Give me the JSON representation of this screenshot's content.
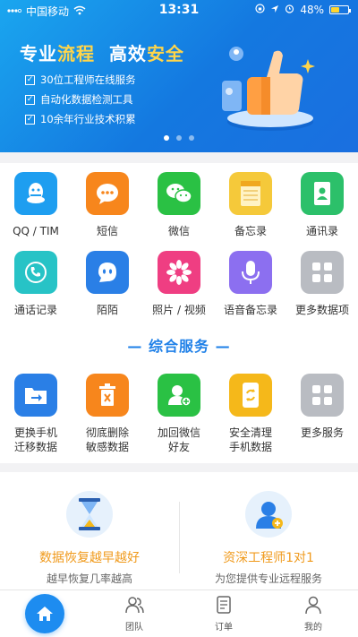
{
  "status_bar": {
    "carrier": "中国移动",
    "time": "13:31",
    "battery": "48%",
    "battery_level": 0.48
  },
  "banner": {
    "headline": {
      "part1": "专业",
      "part2": "流程",
      "part3": "高效",
      "part4": "安全"
    },
    "features": [
      "30位工程师在线服务",
      "自动化数据检测工具",
      "10余年行业技术积累"
    ],
    "carousel": {
      "count": 3,
      "active": 0
    },
    "illustration": "thumbs-up-illustration"
  },
  "data_items": [
    {
      "label": "QQ / TIM",
      "icon": "qq-icon",
      "color": "#1e9ef0"
    },
    {
      "label": "短信",
      "icon": "sms-icon",
      "color": "#f7861c"
    },
    {
      "label": "微信",
      "icon": "wechat-icon",
      "color": "#2ac144"
    },
    {
      "label": "备忘录",
      "icon": "memo-icon",
      "color": "#f5c93a"
    },
    {
      "label": "通讯录",
      "icon": "contacts-icon",
      "color": "#2cc06a"
    },
    {
      "label": "通话记录",
      "icon": "call-log-icon",
      "color": "#27c3c6"
    },
    {
      "label": "陌陌",
      "icon": "momo-icon",
      "color": "#2a7fe6"
    },
    {
      "label": "照片 / 视频",
      "icon": "photo-icon",
      "color": "#ef3e82"
    },
    {
      "label": "语音备忘录",
      "icon": "voice-memo-icon",
      "color": "#8c6ff0"
    },
    {
      "label": "更多数据项",
      "icon": "more-grid-icon",
      "color": "#b9bcc2"
    }
  ],
  "services_title": "— 综合服务 —",
  "services": [
    {
      "line1": "更换手机",
      "line2": "迁移数据",
      "icon": "migrate-icon",
      "color": "#2a7fe6"
    },
    {
      "line1": "彻底删除",
      "line2": "敏感数据",
      "icon": "delete-icon",
      "color": "#f7861c"
    },
    {
      "line1": "加回微信",
      "line2": "好友",
      "icon": "add-friend-icon",
      "color": "#2ac144"
    },
    {
      "line1": "安全清理",
      "line2": "手机数据",
      "icon": "clean-phone-icon",
      "color": "#f5b81a"
    },
    {
      "line1": "更多服务",
      "line2": "",
      "icon": "more-grid-icon",
      "color": "#b9bcc2"
    }
  ],
  "promos": [
    {
      "title": "数据恢复越早越好",
      "subtitle": "越早恢复几率越高",
      "icon": "hourglass-icon"
    },
    {
      "title": "资深工程师1对1",
      "subtitle": "为您提供专业远程服务",
      "icon": "engineer-icon"
    }
  ],
  "tabbar": {
    "tabs": [
      {
        "label": "",
        "icon": "home-icon",
        "active": true
      },
      {
        "label": "团队",
        "icon": "team-icon"
      },
      {
        "label": "订单",
        "icon": "orders-icon"
      },
      {
        "label": "我的",
        "icon": "profile-icon"
      }
    ]
  }
}
